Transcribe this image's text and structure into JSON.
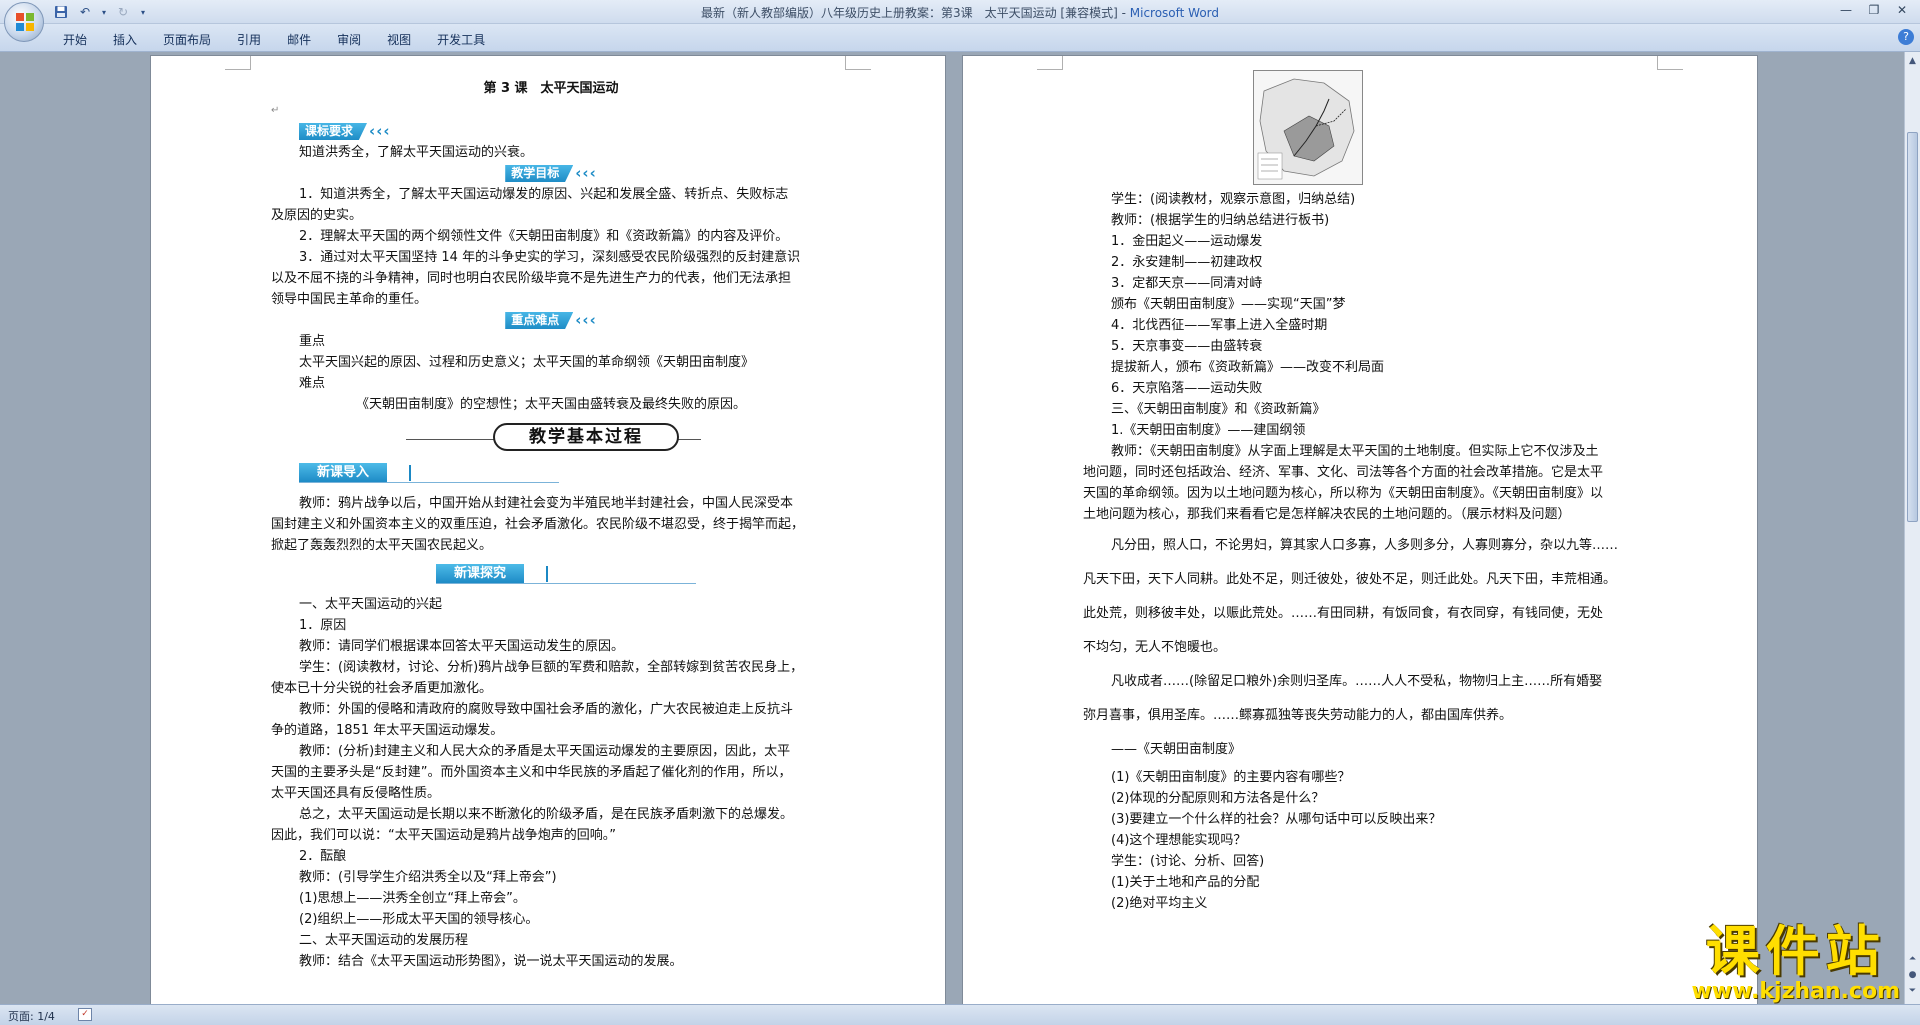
{
  "window": {
    "title_doc": "最新（新人教部编版）八年级历史上册教案：第3课　太平天国运动 [兼容模式] - ",
    "title_app": "Microsoft Word"
  },
  "ribbon": {
    "tabs": [
      "开始",
      "插入",
      "页面布局",
      "引用",
      "邮件",
      "审阅",
      "视图",
      "开发工具"
    ]
  },
  "status": {
    "page_count": "页面: 1/4"
  },
  "left_page": {
    "title": "第 3 课　太平天国运动",
    "b1": "课标要求",
    "p_goal": "知道洪秀全，了解太平天国运动的兴衰。",
    "b2": "教学目标",
    "g1a": "1．知道洪秀全，了解太平天国运动爆发的原因、兴起和发展全盛、转折点、失败标志",
    "g1b": "及原因的史实。",
    "g2": "2．理解太平天国的两个纲领性文件《天朝田亩制度》和《资政新篇》的内容及评价。",
    "g3a": "3．通过对太平天国坚持 14 年的斗争史实的学习，深刻感受农民阶级强烈的反封建意识",
    "g3b": "以及不屈不挠的斗争精神，同时也明白农民阶级毕竟不是先进生产力的代表，他们无法承担",
    "g3c": "领导中国民主革命的重任。",
    "b3": "重点难点",
    "zd": "重点",
    "zd_text": "太平天国兴起的原因、过程和历史意义；太平天国的革命纲领《天朝田亩制度》",
    "nd": "难点",
    "nd_text": "《天朝田亩制度》的空想性；太平天国由盛转衰及最终失败的原因。",
    "big_banner": "教学基本过程",
    "sb1": "新课导入",
    "intro_a": "教师：鸦片战争以后，中国开始从封建社会变为半殖民地半封建社会，中国人民深受本",
    "intro_b": "国封建主义和外国资本主义的双重压迫，社会矛盾激化。农民阶级不堪忍受，终于揭竿而起，",
    "intro_c": "掀起了轰轰烈烈的太平天国农民起义。",
    "sb2": "新课探究",
    "s1": "一、太平天国运动的兴起",
    "s1_1": "1．原因",
    "t1": "教师：请同学们根据课本回答太平天国运动发生的原因。",
    "st1a": "学生：(阅读教材，讨论、分析)鸦片战争巨额的军费和赔款，全部转嫁到贫苦农民身上，",
    "st1b": "使本已十分尖锐的社会矛盾更加激化。",
    "t2a": "教师：外国的侵略和清政府的腐败导致中国社会矛盾的激化，广大农民被迫走上反抗斗",
    "t2b": "争的道路，1851 年太平天国运动爆发。",
    "t3a": "教师：(分析)封建主义和人民大众的矛盾是太平天国运动爆发的主要原因，因此，太平",
    "t3b": "天国的主要矛头是“反封建”。而外国资本主义和中华民族的矛盾起了催化剂的作用，所以，",
    "t3c": "太平天国还具有反侵略性质。",
    "sum_a": "总之，太平天国运动是长期以来不断激化的阶级矛盾，是在民族矛盾刺激下的总爆发。",
    "sum_b": "因此，我们可以说：“太平天国运动是鸦片战争炮声的回响。”",
    "s1_2": "2．酝酿",
    "t4": "教师：(引导学生介绍洪秀全以及“拜上帝会”)",
    "p1": "(1)思想上——洪秀全创立“拜上帝会”。",
    "p2": "(2)组织上——形成太平天国的领导核心。",
    "s2": "二、太平天国运动的发展历程",
    "t5": "教师：结合《太平天国运动形势图》，说一说太平天国运动的发展。"
  },
  "right_page": {
    "r1": "学生：(阅读教材，观察示意图，归纳总结)",
    "r2": "教师：(根据学生的归纳总结进行板书)",
    "r3": "1．金田起义——运动爆发",
    "r4": "2．永安建制——初建政权",
    "r5": "3．定都天京——同清对峙",
    "r6": "颁布《天朝田亩制度》——实现“天国”梦",
    "r7": "4．北伐西征——军事上进入全盛时期",
    "r8": "5．天京事变——由盛转衰",
    "r9": "提拔新人，颁布《资政新篇》——改变不利局面",
    "r10": "6．天京陷落——运动失败",
    "r11": "三、《天朝田亩制度》和《资政新篇》",
    "r12": "1.《天朝田亩制度》——建国纲领",
    "r13a": "教师：《天朝田亩制度》从字面上理解是太平天国的土地制度。但实际上它不仅涉及土",
    "r13b": "地问题，同时还包括政治、经济、军事、文化、司法等各个方面的社会改革措施。它是太平",
    "r13c": "天国的革命纲领。因为以土地问题为核心，所以称为《天朝田亩制度》。《天朝田亩制度》以",
    "r13d": "土地问题为核心，那我们来看看它是怎样解决农民的土地问题的。（展示材料及问题）",
    "q1": "凡分田，照人口，不论男妇，算其家人口多寡，人多则多分，人寡则寡分，杂以九等……",
    "q2": "凡天下田，天下人同耕。此处不足，则迁彼处，彼处不足，则迁此处。凡天下田，丰荒相通。",
    "q3": "此处荒，则移彼丰处，以赈此荒处。……有田同耕，有饭同食，有衣同穿，有钱同使，无处",
    "q4": "不均匀，无人不饱暖也。",
    "q5": "凡收成者……(除留足口粮外)余则归圣库。……人人不受私，物物归上主……所有婚娶",
    "q6": "弥月喜事，俱用圣库。……鳏寡孤独等丧失劳动能力的人，都由国库供养。",
    "src": "——《天朝田亩制度》",
    "qq1": "(1)《天朝田亩制度》的主要内容有哪些？",
    "qq2": "(2)体现的分配原则和方法各是什么？",
    "qq3": "(3)要建立一个什么样的社会？从哪句话中可以反映出来？",
    "qq4": "(4)这个理想能实现吗？",
    "r14": "学生：(讨论、分析、回答)",
    "r15": "(1)关于土地和产品的分配",
    "r16": "(2)绝对平均主义"
  },
  "watermark": {
    "line1": "课件站",
    "line2": "www.kjzhan.com"
  }
}
